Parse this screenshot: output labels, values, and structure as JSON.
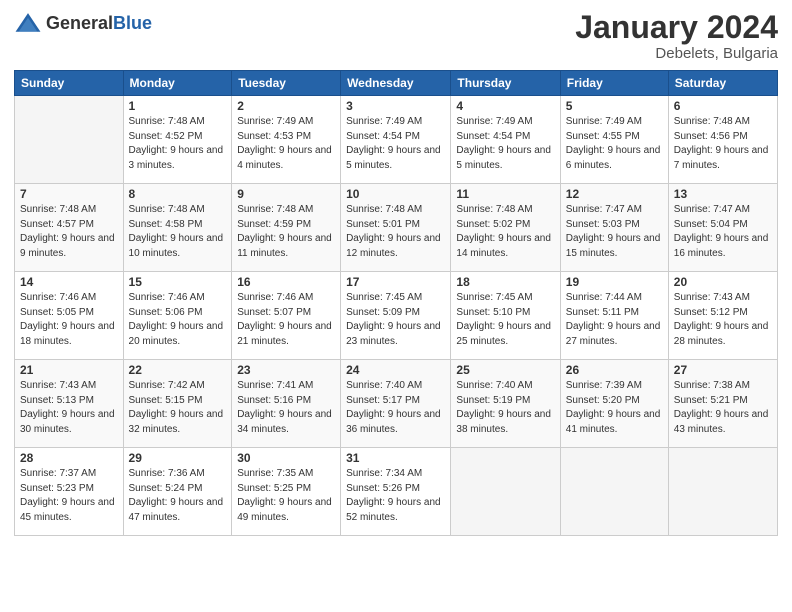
{
  "header": {
    "logo_general": "General",
    "logo_blue": "Blue",
    "month_year": "January 2024",
    "location": "Debelets, Bulgaria"
  },
  "weekdays": [
    "Sunday",
    "Monday",
    "Tuesday",
    "Wednesday",
    "Thursday",
    "Friday",
    "Saturday"
  ],
  "weeks": [
    [
      {
        "day": "",
        "sunrise": "",
        "sunset": "",
        "daylight": ""
      },
      {
        "day": "1",
        "sunrise": "Sunrise: 7:48 AM",
        "sunset": "Sunset: 4:52 PM",
        "daylight": "Daylight: 9 hours and 3 minutes."
      },
      {
        "day": "2",
        "sunrise": "Sunrise: 7:49 AM",
        "sunset": "Sunset: 4:53 PM",
        "daylight": "Daylight: 9 hours and 4 minutes."
      },
      {
        "day": "3",
        "sunrise": "Sunrise: 7:49 AM",
        "sunset": "Sunset: 4:54 PM",
        "daylight": "Daylight: 9 hours and 5 minutes."
      },
      {
        "day": "4",
        "sunrise": "Sunrise: 7:49 AM",
        "sunset": "Sunset: 4:54 PM",
        "daylight": "Daylight: 9 hours and 5 minutes."
      },
      {
        "day": "5",
        "sunrise": "Sunrise: 7:49 AM",
        "sunset": "Sunset: 4:55 PM",
        "daylight": "Daylight: 9 hours and 6 minutes."
      },
      {
        "day": "6",
        "sunrise": "Sunrise: 7:48 AM",
        "sunset": "Sunset: 4:56 PM",
        "daylight": "Daylight: 9 hours and 7 minutes."
      }
    ],
    [
      {
        "day": "7",
        "sunrise": "Sunrise: 7:48 AM",
        "sunset": "Sunset: 4:57 PM",
        "daylight": "Daylight: 9 hours and 9 minutes."
      },
      {
        "day": "8",
        "sunrise": "Sunrise: 7:48 AM",
        "sunset": "Sunset: 4:58 PM",
        "daylight": "Daylight: 9 hours and 10 minutes."
      },
      {
        "day": "9",
        "sunrise": "Sunrise: 7:48 AM",
        "sunset": "Sunset: 4:59 PM",
        "daylight": "Daylight: 9 hours and 11 minutes."
      },
      {
        "day": "10",
        "sunrise": "Sunrise: 7:48 AM",
        "sunset": "Sunset: 5:01 PM",
        "daylight": "Daylight: 9 hours and 12 minutes."
      },
      {
        "day": "11",
        "sunrise": "Sunrise: 7:48 AM",
        "sunset": "Sunset: 5:02 PM",
        "daylight": "Daylight: 9 hours and 14 minutes."
      },
      {
        "day": "12",
        "sunrise": "Sunrise: 7:47 AM",
        "sunset": "Sunset: 5:03 PM",
        "daylight": "Daylight: 9 hours and 15 minutes."
      },
      {
        "day": "13",
        "sunrise": "Sunrise: 7:47 AM",
        "sunset": "Sunset: 5:04 PM",
        "daylight": "Daylight: 9 hours and 16 minutes."
      }
    ],
    [
      {
        "day": "14",
        "sunrise": "Sunrise: 7:46 AM",
        "sunset": "Sunset: 5:05 PM",
        "daylight": "Daylight: 9 hours and 18 minutes."
      },
      {
        "day": "15",
        "sunrise": "Sunrise: 7:46 AM",
        "sunset": "Sunset: 5:06 PM",
        "daylight": "Daylight: 9 hours and 20 minutes."
      },
      {
        "day": "16",
        "sunrise": "Sunrise: 7:46 AM",
        "sunset": "Sunset: 5:07 PM",
        "daylight": "Daylight: 9 hours and 21 minutes."
      },
      {
        "day": "17",
        "sunrise": "Sunrise: 7:45 AM",
        "sunset": "Sunset: 5:09 PM",
        "daylight": "Daylight: 9 hours and 23 minutes."
      },
      {
        "day": "18",
        "sunrise": "Sunrise: 7:45 AM",
        "sunset": "Sunset: 5:10 PM",
        "daylight": "Daylight: 9 hours and 25 minutes."
      },
      {
        "day": "19",
        "sunrise": "Sunrise: 7:44 AM",
        "sunset": "Sunset: 5:11 PM",
        "daylight": "Daylight: 9 hours and 27 minutes."
      },
      {
        "day": "20",
        "sunrise": "Sunrise: 7:43 AM",
        "sunset": "Sunset: 5:12 PM",
        "daylight": "Daylight: 9 hours and 28 minutes."
      }
    ],
    [
      {
        "day": "21",
        "sunrise": "Sunrise: 7:43 AM",
        "sunset": "Sunset: 5:13 PM",
        "daylight": "Daylight: 9 hours and 30 minutes."
      },
      {
        "day": "22",
        "sunrise": "Sunrise: 7:42 AM",
        "sunset": "Sunset: 5:15 PM",
        "daylight": "Daylight: 9 hours and 32 minutes."
      },
      {
        "day": "23",
        "sunrise": "Sunrise: 7:41 AM",
        "sunset": "Sunset: 5:16 PM",
        "daylight": "Daylight: 9 hours and 34 minutes."
      },
      {
        "day": "24",
        "sunrise": "Sunrise: 7:40 AM",
        "sunset": "Sunset: 5:17 PM",
        "daylight": "Daylight: 9 hours and 36 minutes."
      },
      {
        "day": "25",
        "sunrise": "Sunrise: 7:40 AM",
        "sunset": "Sunset: 5:19 PM",
        "daylight": "Daylight: 9 hours and 38 minutes."
      },
      {
        "day": "26",
        "sunrise": "Sunrise: 7:39 AM",
        "sunset": "Sunset: 5:20 PM",
        "daylight": "Daylight: 9 hours and 41 minutes."
      },
      {
        "day": "27",
        "sunrise": "Sunrise: 7:38 AM",
        "sunset": "Sunset: 5:21 PM",
        "daylight": "Daylight: 9 hours and 43 minutes."
      }
    ],
    [
      {
        "day": "28",
        "sunrise": "Sunrise: 7:37 AM",
        "sunset": "Sunset: 5:23 PM",
        "daylight": "Daylight: 9 hours and 45 minutes."
      },
      {
        "day": "29",
        "sunrise": "Sunrise: 7:36 AM",
        "sunset": "Sunset: 5:24 PM",
        "daylight": "Daylight: 9 hours and 47 minutes."
      },
      {
        "day": "30",
        "sunrise": "Sunrise: 7:35 AM",
        "sunset": "Sunset: 5:25 PM",
        "daylight": "Daylight: 9 hours and 49 minutes."
      },
      {
        "day": "31",
        "sunrise": "Sunrise: 7:34 AM",
        "sunset": "Sunset: 5:26 PM",
        "daylight": "Daylight: 9 hours and 52 minutes."
      },
      {
        "day": "",
        "sunrise": "",
        "sunset": "",
        "daylight": ""
      },
      {
        "day": "",
        "sunrise": "",
        "sunset": "",
        "daylight": ""
      },
      {
        "day": "",
        "sunrise": "",
        "sunset": "",
        "daylight": ""
      }
    ]
  ]
}
